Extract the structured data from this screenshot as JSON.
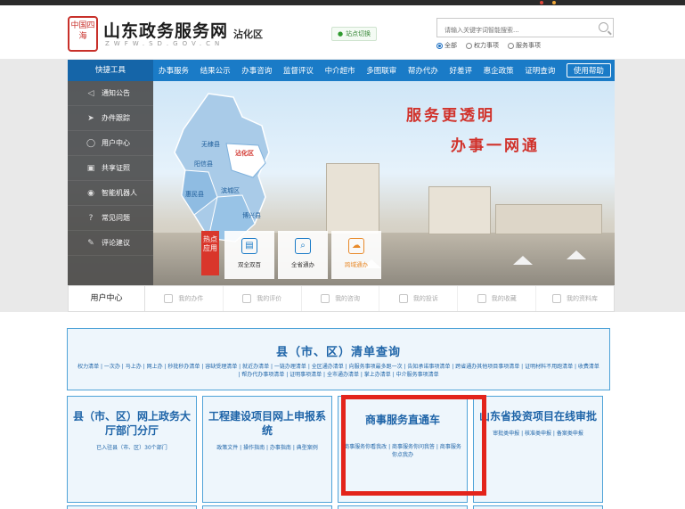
{
  "header": {
    "logo_seal_text": "中国四海",
    "site_title": "山东政务服务网",
    "site_subtitle": "ZWFW.SD.GOV.CN",
    "district": "沾化区",
    "switch_label": "站点切换",
    "search_placeholder": "请输入关键字词智能搜索...",
    "radios": [
      {
        "label": "全部",
        "selected": true
      },
      {
        "label": "权力事项",
        "selected": false
      },
      {
        "label": "服务事项",
        "selected": false
      }
    ]
  },
  "nav": {
    "quick_tools": "快捷工具",
    "items": [
      "办事服务",
      "结果公示",
      "办事咨询",
      "监督评议",
      "中介超市",
      "多图联审",
      "帮办代办",
      "好差评",
      "惠企政策",
      "证明查询"
    ],
    "help": "使用帮助"
  },
  "sidebar": {
    "items": [
      {
        "label": "通知公告",
        "icon": "speaker-icon"
      },
      {
        "label": "办件跟踪",
        "icon": "send-icon"
      },
      {
        "label": "用户中心",
        "icon": "user-icon"
      },
      {
        "label": "共享证照",
        "icon": "id-card-icon"
      },
      {
        "label": "智能机器人",
        "icon": "robot-icon"
      },
      {
        "label": "常见问题",
        "icon": "question-icon"
      },
      {
        "label": "评论建议",
        "icon": "edit-icon"
      }
    ]
  },
  "banner": {
    "slogan_1": "服务更透明",
    "slogan_2": "办事一网通",
    "map_labels": [
      "无棣县",
      "沾化区",
      "阳信县",
      "滨城区",
      "惠民县",
      "博兴县"
    ],
    "hot_tag": "热点应用",
    "cards": [
      {
        "label": "双全双百",
        "icon": "document-icon"
      },
      {
        "label": "全省通办",
        "icon": "scan-icon"
      },
      {
        "label": "跨域通办",
        "icon": "cloud-icon"
      }
    ]
  },
  "user_center": {
    "title": "用户中心",
    "items": [
      "我的办件",
      "我的评价",
      "我的咨询",
      "我的投诉",
      "我的收藏",
      "我的资料库"
    ]
  },
  "list_query": {
    "title": "县（市、区）清单查询",
    "links": "权力清单 | 一次办 | 马上办 | 网上办 | 秒批秒办清单 | 容缺受理清单 | 就近办清单 | 一链办理清单 | 全区通办清单 | 向服务事项最多跑一次 | 告知承诺事项清单 | 跨省通办其他项目事项清单 | 证明材料不用跑清单 | 收费清单 | 帮办代办事项清单 | 证明事项清单 | 全市通办清单 | 掌上办清单 | 中介服务事项清单"
  },
  "tiles": [
    {
      "title": "县（市、区）网上政务大厅部门分厅",
      "desc": "已入驻县（市、区）30个部门"
    },
    {
      "title": "工程建设项目网上申报系统",
      "desc": "政策文件 | 操作指南 | 办事指南 | 典型案例"
    },
    {
      "title": "商事服务直通车",
      "desc": "商事服务你看我改 | 商事服务你问我答 | 商事服务你点我办"
    },
    {
      "title": "山东省投资项目在线审批",
      "desc": "审批类申报 | 核准类申报 | 备案类申报"
    }
  ],
  "colors": {
    "nav_blue": "#1a7bc7",
    "accent_red": "#d1322b",
    "tile_border": "#4fa3d8",
    "highlight_red": "#e3241b"
  }
}
